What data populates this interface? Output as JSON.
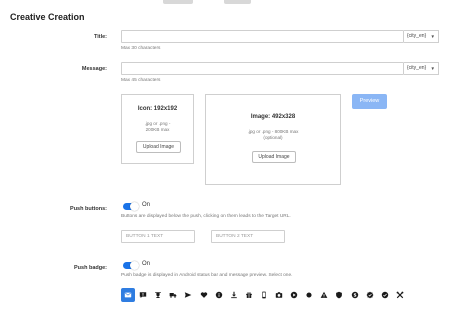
{
  "page": {
    "title": "Creative Creation"
  },
  "form": {
    "title_row": {
      "label": "Title:",
      "value": "",
      "macro": "{city_en}",
      "hint": "Max 30 characters"
    },
    "message_row": {
      "label": "Message:",
      "value": "",
      "macro": "{city_en}",
      "hint": "Max 45 characters"
    },
    "icon_upload": {
      "title": "Icon: 192x192",
      "desc_line1": ".jpg or .png -",
      "desc_line2": "200KB max",
      "button": "Upload Image"
    },
    "image_upload": {
      "title": "Image: 492x328",
      "desc_line1": ".jpg or .png - 800KB max",
      "desc_line2": "(optional)",
      "button": "Upload Image"
    },
    "preview_button": "Preview",
    "push_buttons": {
      "label": "Push buttons:",
      "toggle_state": "On",
      "hint": "Buttons are displayed below the push, clicking on them leads to the Target URL.",
      "button1_placeholder": "BUTTON 1 TEXT",
      "button2_placeholder": "BUTTON 2 TEXT"
    },
    "push_badge": {
      "label": "Push badge:",
      "toggle_state": "On",
      "hint": "Push badge is displayed in Android status bar and message preview. Select one.",
      "icons": [
        "mail-icon",
        "chat-alert-icon",
        "trophy-icon",
        "truck-icon",
        "send-icon",
        "heart-icon",
        "info-icon",
        "download-icon",
        "gift-icon",
        "phone-icon",
        "camera-icon",
        "play-icon",
        "record-icon",
        "warning-icon",
        "shield-icon",
        "dollar-icon",
        "verified-icon",
        "check-icon",
        "tools-icon"
      ],
      "selected_index": 0
    }
  },
  "colors": {
    "accent": "#1a73e8",
    "preview": "#8ab6f5",
    "selected_badge": "#2f7de1"
  }
}
